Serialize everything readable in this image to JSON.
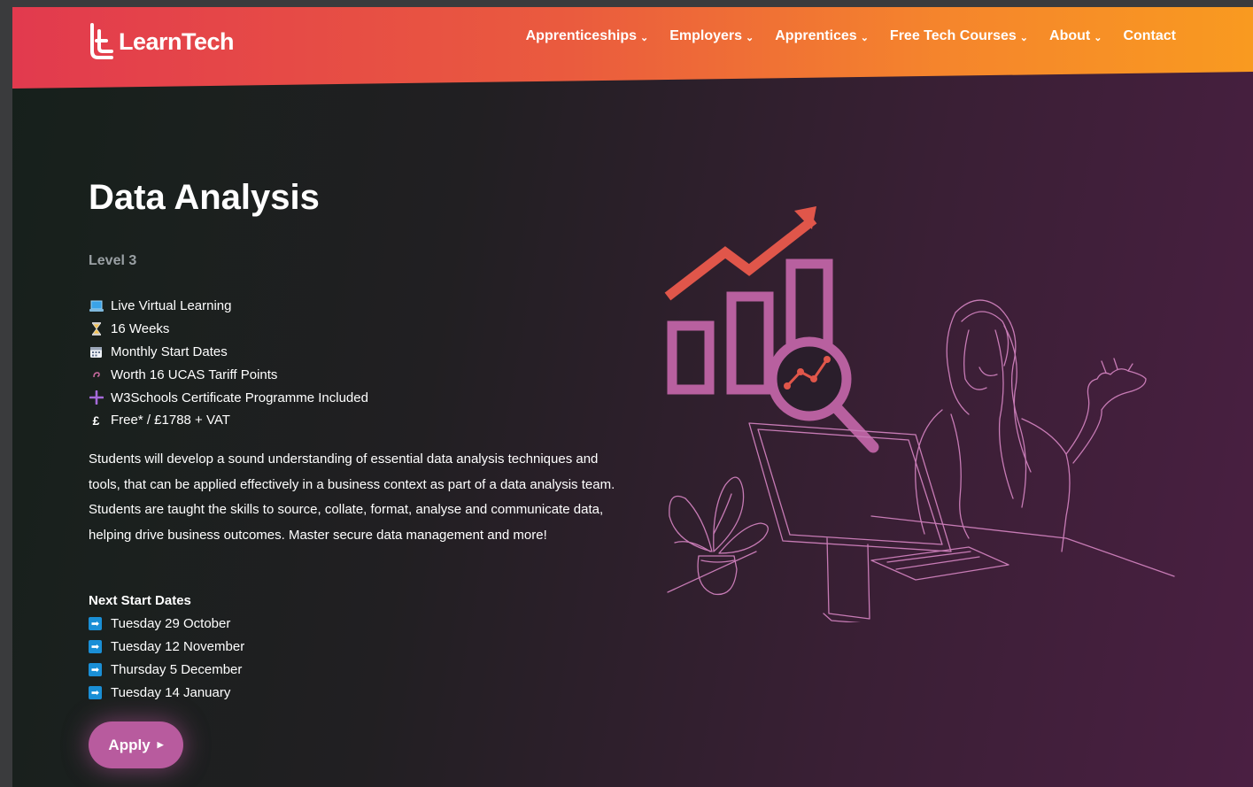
{
  "header": {
    "logo_text": "LearnTech",
    "nav": [
      {
        "label": "Apprenticeships",
        "dropdown": true
      },
      {
        "label": "Employers",
        "dropdown": true
      },
      {
        "label": "Apprentices",
        "dropdown": true
      },
      {
        "label": "Free Tech Courses",
        "dropdown": true
      },
      {
        "label": "About",
        "dropdown": true
      },
      {
        "label": "Contact",
        "dropdown": false
      }
    ],
    "chevron": "⌄"
  },
  "course": {
    "title": "Data Analysis",
    "level": "Level 3",
    "features": [
      {
        "icon": "laptop-icon",
        "label": "Live Virtual Learning"
      },
      {
        "icon": "hourglass-icon",
        "label": "16 Weeks"
      },
      {
        "icon": "calendar-icon",
        "label": "Monthly Start Dates"
      },
      {
        "icon": "spiral-icon",
        "label": "Worth 16 UCAS Tariff Points"
      },
      {
        "icon": "plus-icon",
        "label": "W3Schools Certificate Programme Included"
      },
      {
        "icon": "pound-icon",
        "label": "Free* / £1788 + VAT"
      }
    ],
    "description": "Students will develop a sound understanding of essential data analysis techniques and tools, that can be applied effectively in a business context as part of a data analysis team. Students are taught the skills to source, collate, format, analyse and communicate data, helping drive business outcomes. Master secure data management and more!",
    "next_start_title": "Next Start Dates",
    "start_dates": [
      "Tuesday 29 October",
      "Tuesday 12 November",
      "Thursday 5 December",
      "Tuesday 14 January"
    ],
    "apply_label": "Apply"
  },
  "colors": {
    "header_start": "#e23a4e",
    "header_end": "#f99a20",
    "accent_pink": "#b85b9e",
    "chart_arrow": "#e0564a",
    "date_arrow": "#1a8fd6"
  }
}
